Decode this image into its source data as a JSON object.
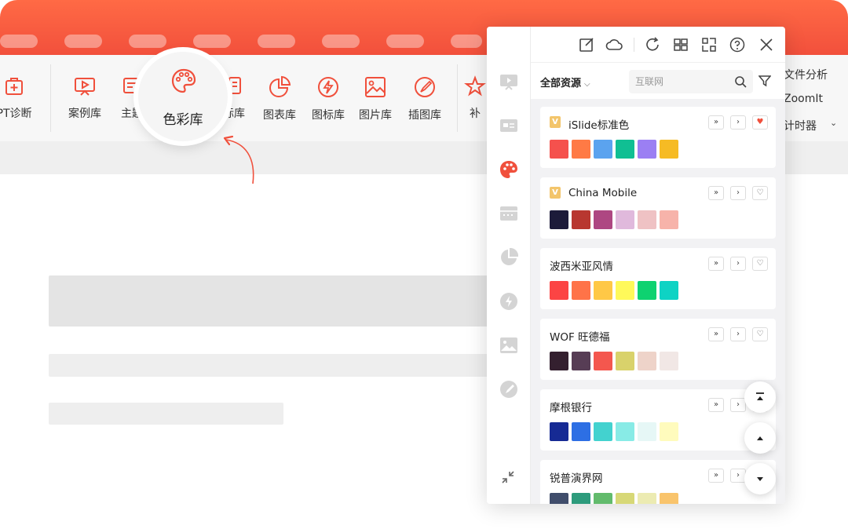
{
  "ribbon": {
    "items": [
      {
        "label": "PPT诊断",
        "icon": "diagnosis-icon"
      },
      {
        "label": "案例库",
        "icon": "case-library-icon"
      },
      {
        "label": "主题库",
        "icon": "theme-library-icon"
      },
      {
        "label": "色彩库",
        "icon": "palette-icon"
      },
      {
        "label": "图标库",
        "icon": "icon-library-icon"
      },
      {
        "label": "图表库",
        "icon": "chart-library-icon"
      },
      {
        "label": "图标库",
        "icon": "lightning-icon"
      },
      {
        "label": "图片库",
        "icon": "image-library-icon"
      },
      {
        "label": "插图库",
        "icon": "illustration-library-icon"
      },
      {
        "label": "补",
        "icon": "star-icon"
      }
    ],
    "visible_labels": {
      "ppt_diag": "PT诊断",
      "case": "案例库",
      "theme": "主题",
      "icon_lib_partial": "标库",
      "chart": "图表库",
      "iconlib": "图标库",
      "image": "图片库",
      "illustration": "插图库",
      "extra_partial": "补"
    },
    "right_menu": {
      "file_analysis": "文件分析",
      "zoomit": "ZoomIt",
      "timer": "计时器"
    },
    "colors": {
      "accent": "#f0503c",
      "titlebar_top": "#ff6a45"
    }
  },
  "magnifier": {
    "label": "色彩库",
    "icon": "palette-icon"
  },
  "panel": {
    "rail_icons": [
      "slideshow-icon",
      "card-icon",
      "palette-icon",
      "layout-icon",
      "pie-chart-icon",
      "lightning-icon",
      "image-icon",
      "brush-icon"
    ],
    "toolbar_icons": [
      "edit-icon",
      "cloud-icon",
      "refresh-icon",
      "grid-icon",
      "scan-icon",
      "help-icon",
      "close-icon"
    ],
    "scope": "全部资源",
    "search_placeholder": "互联网",
    "palettes": [
      {
        "name": "iSlide标准色",
        "badge": "V",
        "favorited": true,
        "colors": [
          "#f5514d",
          "#ff7a45",
          "#5ba3ef",
          "#10bf93",
          "#9b7ff3",
          "#f6bb24"
        ]
      },
      {
        "name": "China Mobile",
        "badge": "V",
        "favorited": false,
        "colors": [
          "#1c1b3a",
          "#b83730",
          "#ae4782",
          "#e0b9dc",
          "#efc2c4",
          "#f7b3aa"
        ]
      },
      {
        "name": "波西米亚风情",
        "badge": "",
        "favorited": false,
        "colors": [
          "#fc4444",
          "#ff7348",
          "#ffc846",
          "#fff95a",
          "#0ed270",
          "#0ed3c4"
        ]
      },
      {
        "name": "WOF 旺德福",
        "badge": "",
        "favorited": false,
        "colors": [
          "#34202f",
          "#573d55",
          "#f4574e",
          "#d9d26b",
          "#eed3c9",
          "#f1e7e5"
        ]
      },
      {
        "name": "摩根银行",
        "badge": "",
        "favorited": false,
        "colors": [
          "#162a94",
          "#2d6fe4",
          "#43d2cf",
          "#88ebe6",
          "#e6f7f6",
          "#fffbbd"
        ]
      },
      {
        "name": "锐普演界网",
        "badge": "",
        "favorited": false,
        "colors": [
          "#404d6b",
          "#2d9b7c",
          "#62bb6c",
          "#d7d877",
          "#ecebb2",
          "#f9c46c"
        ]
      }
    ],
    "fab_icons": [
      "scroll-top-icon",
      "scroll-up-icon",
      "scroll-down-icon"
    ],
    "collapse_icon": "collapse-icon"
  }
}
